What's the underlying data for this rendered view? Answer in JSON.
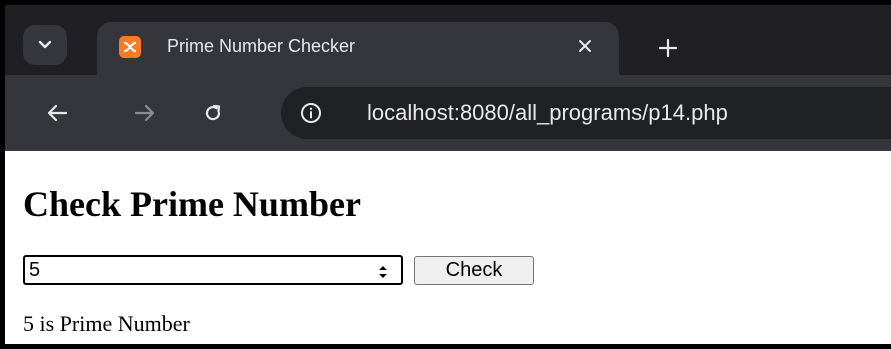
{
  "browser": {
    "tab": {
      "title": "Prime Number Checker",
      "favicon": "xampp-icon",
      "favicon_color": "#fb7a24"
    },
    "icons": {
      "tab_search": "chevron-down-icon",
      "tab_close": "close-icon",
      "new_tab": "plus-icon",
      "back": "arrow-left-icon",
      "forward": "arrow-right-icon",
      "reload": "reload-icon",
      "site_info": "info-icon"
    },
    "url": "localhost:8080/all_programs/p14.php",
    "colors": {
      "tabstrip_bg": "#1f1f24",
      "toolbar_bg": "#35363b",
      "omnibox_bg": "#202124",
      "text": "#e8e8ea"
    }
  },
  "page": {
    "heading": "Check Prime Number",
    "number_input_value": "5",
    "check_button_label": "Check",
    "result_text": "5 is Prime Number"
  }
}
